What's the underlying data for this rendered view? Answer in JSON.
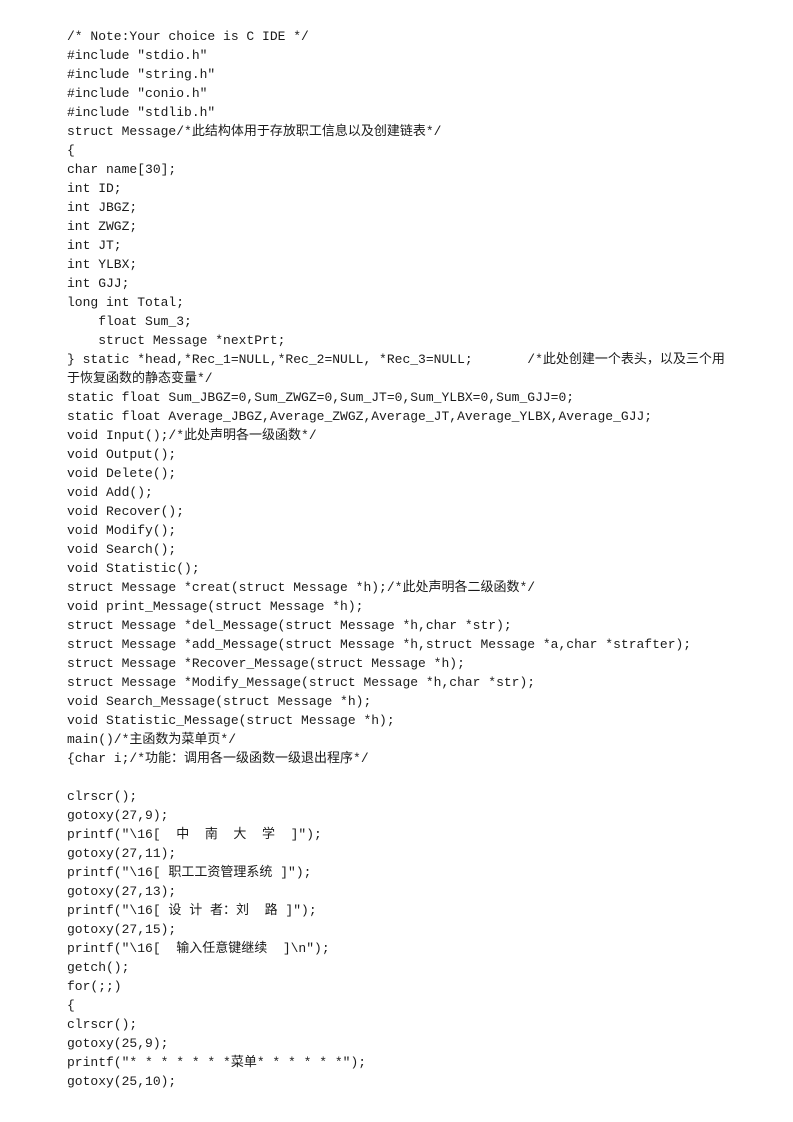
{
  "document": {
    "lines": [
      "/* Note:Your choice is C IDE */",
      "#include \"stdio.h\"",
      "#include \"string.h\"",
      "#include \"conio.h\"",
      "#include \"stdlib.h\"",
      "struct Message/*此结构体用于存放职工信息以及创建链表*/",
      "{",
      "char name[30];",
      "int ID;",
      "int JBGZ;",
      "int ZWGZ;",
      "int JT;",
      "int YLBX;",
      "int GJJ;",
      "long int Total;",
      "    float Sum_3;",
      "    struct Message *nextPrt;",
      "} static *head,*Rec_1=NULL,*Rec_2=NULL, *Rec_3=NULL;       /*此处创建一个表头，以及三个用",
      "于恢复函数的静态变量*/",
      "static float Sum_JBGZ=0,Sum_ZWGZ=0,Sum_JT=0,Sum_YLBX=0,Sum_GJJ=0;",
      "static float Average_JBGZ,Average_ZWGZ,Average_JT,Average_YLBX,Average_GJJ;",
      "void Input();/*此处声明各一级函数*/",
      "void Output();",
      "void Delete();",
      "void Add();",
      "void Recover();",
      "void Modify();",
      "void Search();",
      "void Statistic();",
      "struct Message *creat(struct Message *h);/*此处声明各二级函数*/",
      "void print_Message(struct Message *h);",
      "struct Message *del_Message(struct Message *h,char *str);",
      "struct Message *add_Message(struct Message *h,struct Message *a,char *strafter);",
      "struct Message *Recover_Message(struct Message *h);",
      "struct Message *Modify_Message(struct Message *h,char *str);",
      "void Search_Message(struct Message *h);",
      "void Statistic_Message(struct Message *h);",
      "main()/*主函数为菜单页*/",
      "{char i;/*功能：调用各一级函数一级退出程序*/",
      "",
      "clrscr();",
      "gotoxy(27,9);",
      "printf(\"\\16[  中  南  大  学  ]\");",
      "gotoxy(27,11);",
      "printf(\"\\16[ 职工工资管理系统 ]\");",
      "gotoxy(27,13);",
      "printf(\"\\16[ 设 计 者：刘  路 ]\");",
      "gotoxy(27,15);",
      "printf(\"\\16[  输入任意键继续  ]\\n\");",
      "getch();",
      "for(;;)",
      "{",
      "clrscr();",
      "gotoxy(25,9);",
      "printf(\"* * * * * * *菜单* * * * * *\");",
      "gotoxy(25,10);"
    ]
  }
}
